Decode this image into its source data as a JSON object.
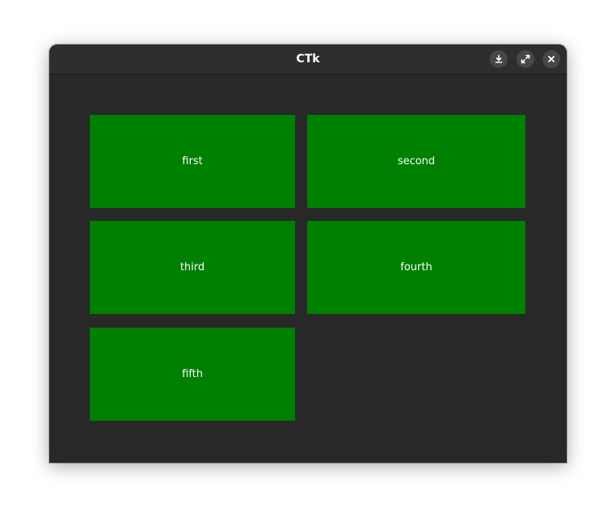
{
  "window": {
    "title": "CTk"
  },
  "titlebar_buttons": [
    {
      "icon": "minimize-icon"
    },
    {
      "icon": "maximize-icon"
    },
    {
      "icon": "close-icon"
    }
  ],
  "tiles": [
    {
      "label": "first"
    },
    {
      "label": "second"
    },
    {
      "label": "third"
    },
    {
      "label": "fourth"
    },
    {
      "label": "fifth"
    }
  ],
  "colors": {
    "tile_bg": "#008000",
    "window_bg": "#282828",
    "titlebar_bg": "#2e2e2e"
  }
}
